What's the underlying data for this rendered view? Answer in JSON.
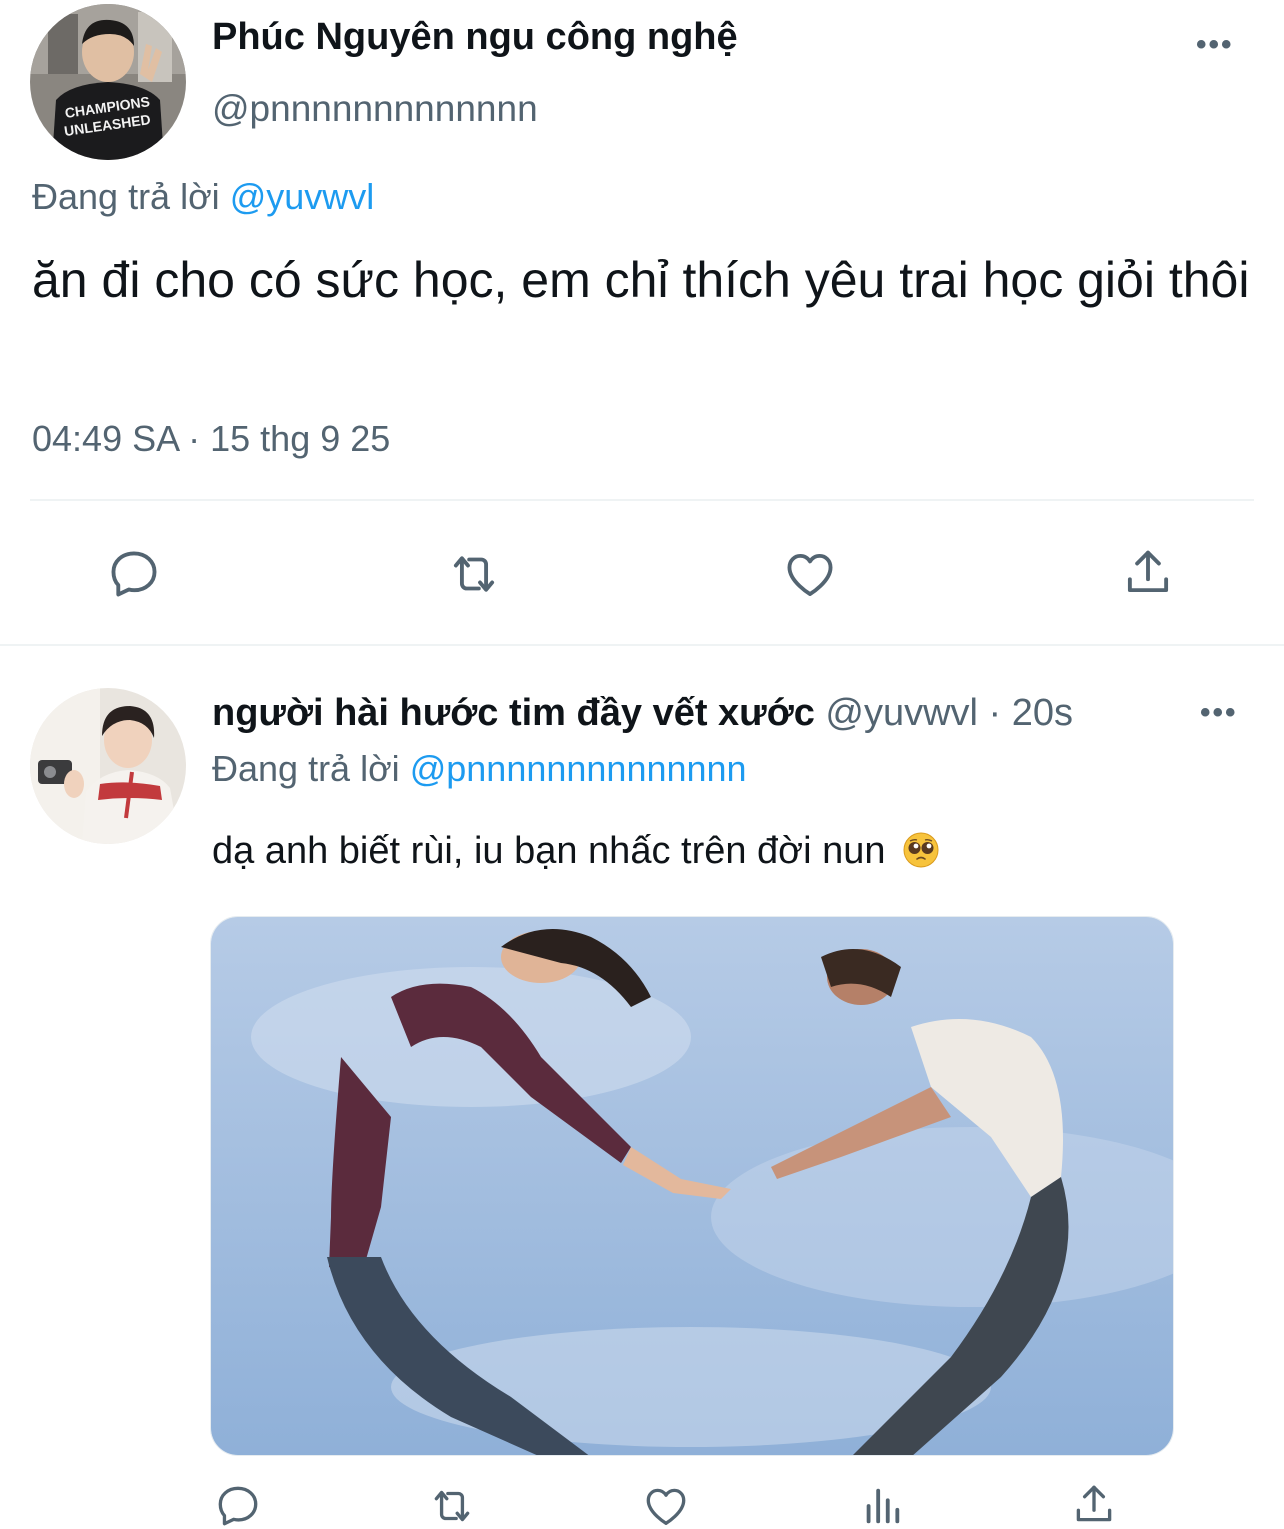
{
  "main_tweet": {
    "display_name": "Phúc Nguyên ngu công nghệ",
    "handle": "@pnnnnnnnnnnnnn",
    "reply_prefix": "Đang trả lời",
    "reply_mention": "@yuvwvl",
    "text": "ăn đi cho có sức học, em chỉ thích yêu trai học giỏi thôi",
    "timestamp": "04:49 SA · 15 thg 9 25",
    "more_label": "•••",
    "actions": [
      "reply-icon",
      "retweet-icon",
      "like-icon",
      "share-icon"
    ]
  },
  "reply_tweet": {
    "display_name": "người hài hước tim đầy vết xước",
    "handle_time": "@yuvwvl · 20s",
    "reply_prefix": "Đang trả lời",
    "reply_mention": "@pnnnnnnnnnnnnnn",
    "text": "dạ anh biết rùi, iu bạn nhấc trên đời nun",
    "emoji": "pleading-face",
    "more_label": "•••",
    "actions": [
      "reply-icon",
      "retweet-icon",
      "like-icon",
      "views-icon",
      "share-icon"
    ]
  },
  "colors": {
    "text_primary": "#0f1419",
    "text_secondary": "#536471",
    "link": "#1d9bf0",
    "divider": "#eff3f4"
  }
}
